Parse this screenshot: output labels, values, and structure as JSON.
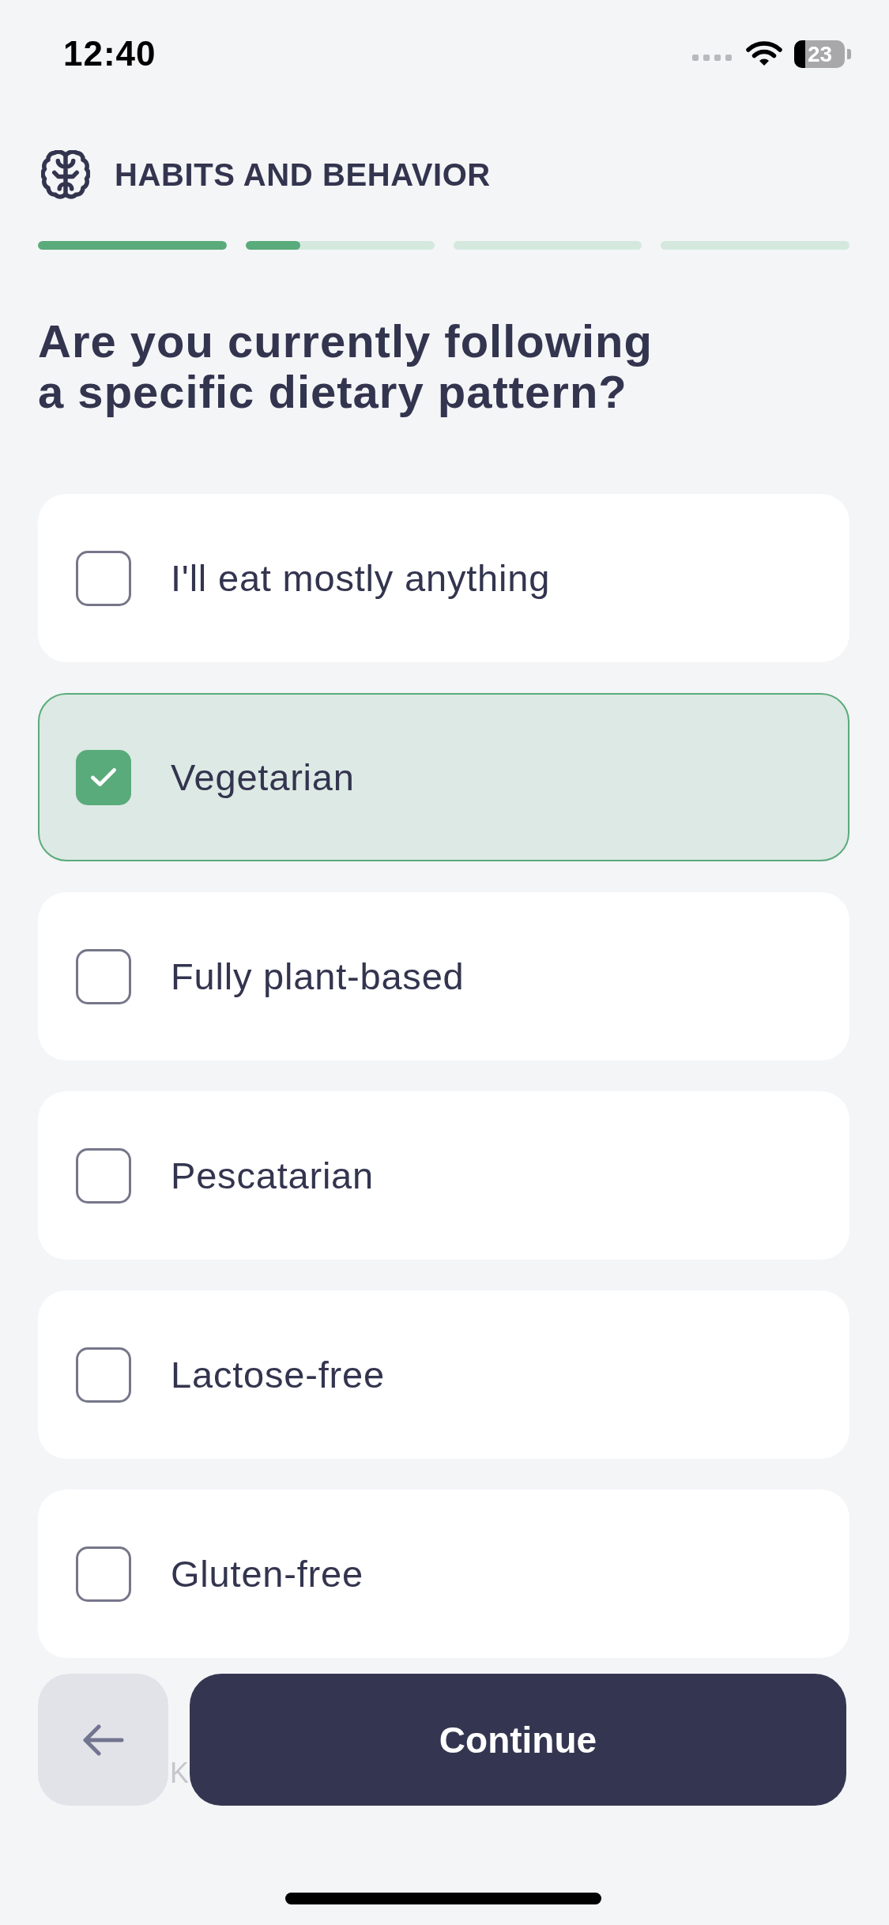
{
  "status_bar": {
    "time": "12:40",
    "battery": "23"
  },
  "header": {
    "title": "HABITS AND BEHAVIOR"
  },
  "progress": [
    {
      "level": 1
    },
    {
      "level": 0.29
    },
    {
      "level": 0
    },
    {
      "level": 0
    }
  ],
  "question": "Are you currently following a specific dietary pattern?",
  "options": [
    {
      "label": "I'll eat mostly anything",
      "checked": false
    },
    {
      "label": "Vegetarian",
      "checked": true
    },
    {
      "label": "Fully plant-based",
      "checked": false
    },
    {
      "label": "Pescatarian",
      "checked": false
    },
    {
      "label": "Lactose-free",
      "checked": false
    },
    {
      "label": "Gluten-free",
      "checked": false
    }
  ],
  "partial_option": {
    "label": "K"
  },
  "continue_button": {
    "label": "Continue"
  }
}
